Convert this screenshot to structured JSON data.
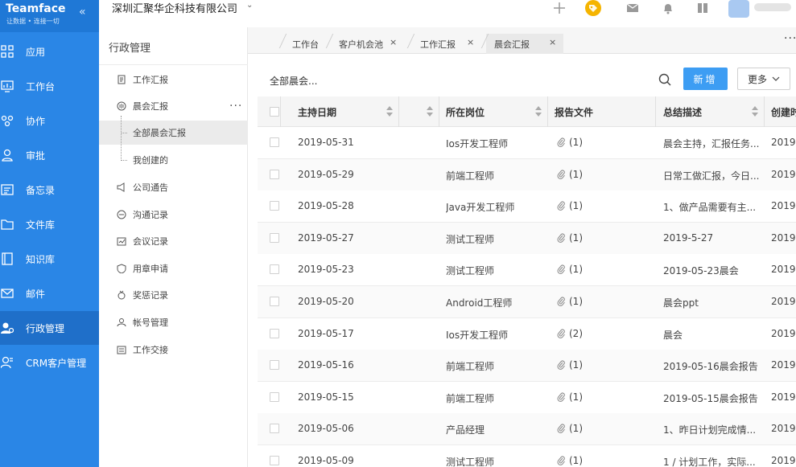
{
  "brand": {
    "name": "Teamface",
    "slogan": "让数据 • 连接一切"
  },
  "nav": [
    {
      "label": "应用",
      "icon": "apps-icon"
    },
    {
      "label": "工作台",
      "icon": "dashboard-icon"
    },
    {
      "label": "协作",
      "icon": "collaborate-icon"
    },
    {
      "label": "审批",
      "icon": "approval-icon"
    },
    {
      "label": "备忘录",
      "icon": "memo-icon"
    },
    {
      "label": "文件库",
      "icon": "folder-icon"
    },
    {
      "label": "知识库",
      "icon": "book-icon"
    },
    {
      "label": "邮件",
      "icon": "mail-icon"
    },
    {
      "label": "行政管理",
      "icon": "admin-icon",
      "active": true
    },
    {
      "label": "CRM客户管理",
      "icon": "crm-icon"
    }
  ],
  "header": {
    "company": "深圳汇聚华企科技有限公司"
  },
  "submenu": {
    "title": "行政管理",
    "items": [
      {
        "label": "工作汇报",
        "icon": "report-icon"
      },
      {
        "label": "晨会汇报",
        "icon": "morning-meeting-icon"
      },
      {
        "label": "全部晨会汇报",
        "child": true,
        "active": true
      },
      {
        "label": "我创建的",
        "child": true
      },
      {
        "label": "公司通告",
        "icon": "megaphone-icon"
      },
      {
        "label": "沟通记录",
        "icon": "chat-icon"
      },
      {
        "label": "会议记录",
        "icon": "meeting-icon"
      },
      {
        "label": "用章申请",
        "icon": "seal-icon"
      },
      {
        "label": "奖惩记录",
        "icon": "medal-icon"
      },
      {
        "label": "帐号管理",
        "icon": "account-icon"
      },
      {
        "label": "工作交接",
        "icon": "handover-icon"
      }
    ]
  },
  "tabs": [
    {
      "label": "工作台",
      "closable": false
    },
    {
      "label": "客户机会池",
      "closable": true
    },
    {
      "label": "工作汇报",
      "closable": true
    },
    {
      "label": "晨会汇报",
      "closable": true,
      "active": true
    }
  ],
  "toolbar": {
    "filter_label": "全部晨会...",
    "new_label": "新增",
    "more_label": "更多"
  },
  "table": {
    "columns": [
      "主持日期",
      "",
      "所在岗位",
      "报告文件",
      "总结描述",
      "创建时"
    ],
    "rows": [
      {
        "date": "2019-05-31",
        "position": "Ios开发工程师",
        "files": "(1)",
        "summary": "晨会主持，汇报任务...",
        "created": "2019"
      },
      {
        "date": "2019-05-29",
        "position": "前端工程师",
        "files": "(1)",
        "summary": "日常工做汇报，今日...",
        "created": "2019"
      },
      {
        "date": "2019-05-28",
        "position": "Java开发工程师",
        "files": "(1)",
        "summary": "1、做产品需要有主...",
        "created": "2019"
      },
      {
        "date": "2019-05-27",
        "position": "测试工程师",
        "files": "(1)",
        "summary": "2019-5-27",
        "created": "2019"
      },
      {
        "date": "2019-05-23",
        "position": "测试工程师",
        "files": "(1)",
        "summary": "2019-05-23晨会",
        "created": "2019"
      },
      {
        "date": "2019-05-20",
        "position": "Android工程师",
        "files": "(1)",
        "summary": "晨会ppt",
        "created": "2019"
      },
      {
        "date": "2019-05-17",
        "position": "Ios开发工程师",
        "files": "(2)",
        "summary": "晨会",
        "created": "2019"
      },
      {
        "date": "2019-05-16",
        "position": "前端工程师",
        "files": "(1)",
        "summary": "2019-05-16晨会报告",
        "created": "2019"
      },
      {
        "date": "2019-05-15",
        "position": "前端工程师",
        "files": "(1)",
        "summary": "2019-05-15晨会报告",
        "created": "2019"
      },
      {
        "date": "2019-05-06",
        "position": "产品经理",
        "files": "(1)",
        "summary": "1、昨日计划完成情...",
        "created": "2019"
      },
      {
        "date": "2019-05-09",
        "position": "测试工程师",
        "files": "(1)",
        "summary": "1 / 计划工作，实际...",
        "created": "2019"
      }
    ]
  },
  "colors": {
    "nav_bg": "#2a86e6",
    "nav_active": "#1f6fc9",
    "primary_button": "#3d9df3",
    "tag": "#f5b400"
  }
}
